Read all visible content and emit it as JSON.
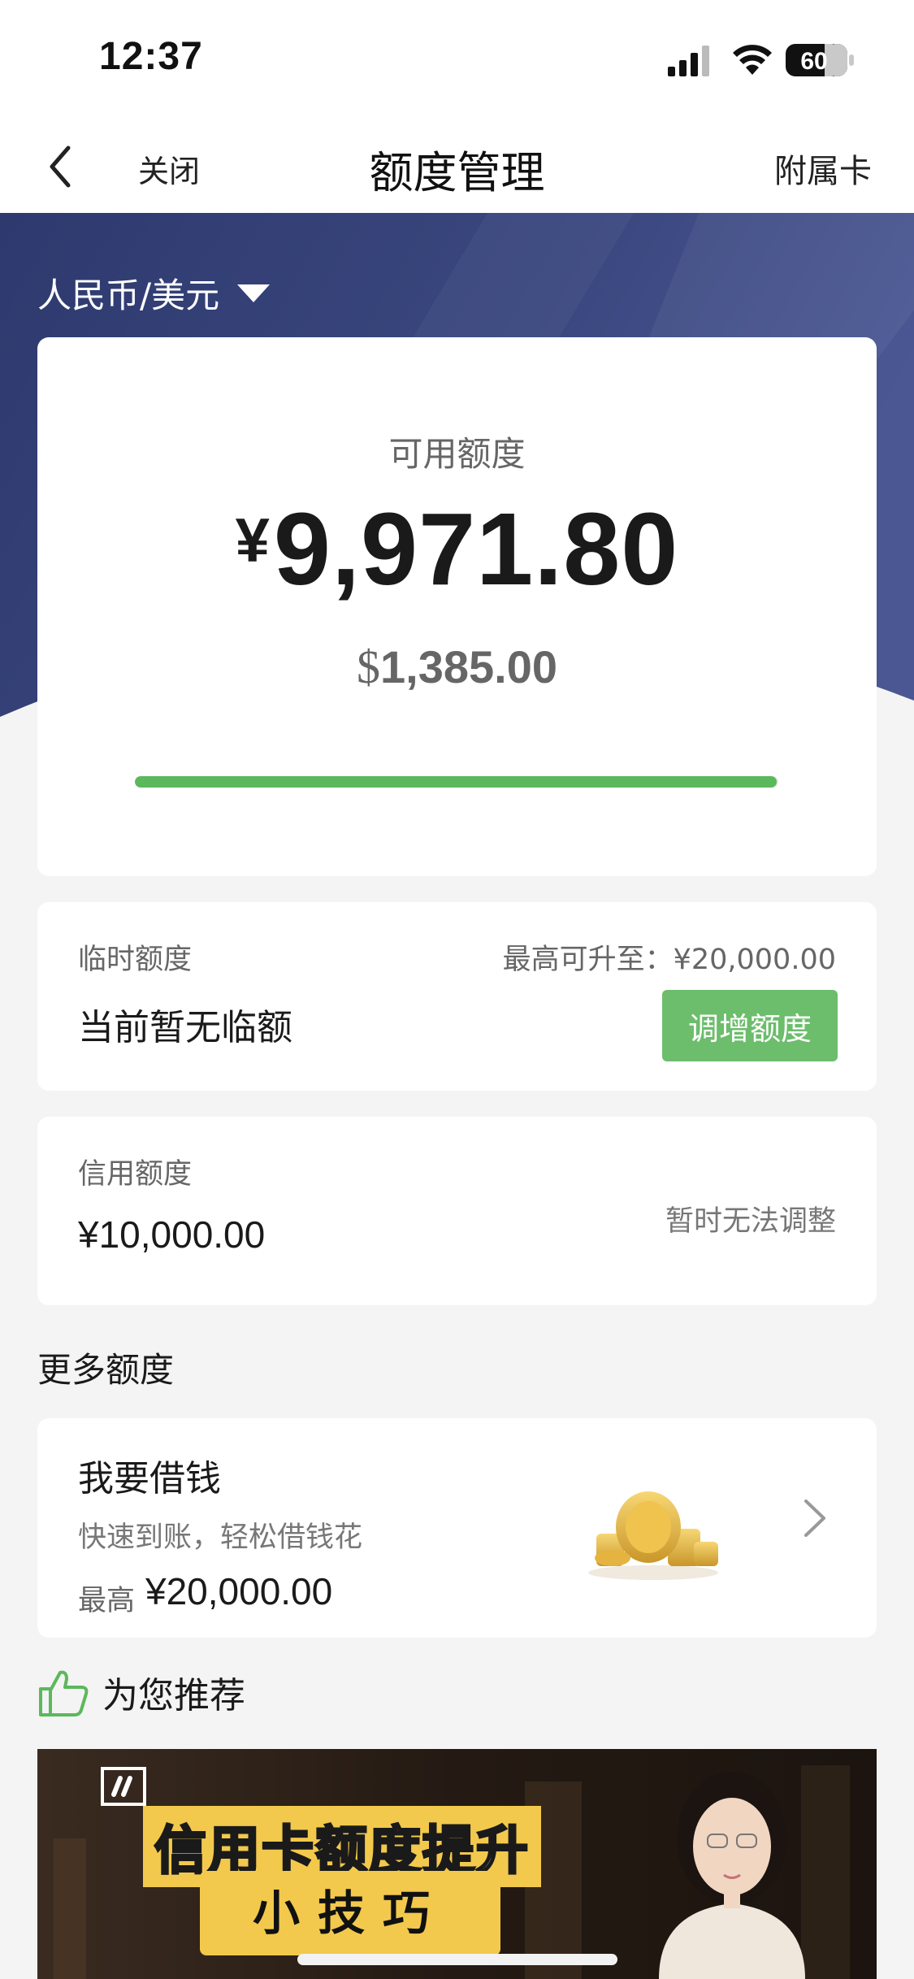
{
  "status_bar": {
    "time": "12:37",
    "battery": "60"
  },
  "nav": {
    "close_label": "关闭",
    "title": "额度管理",
    "right_label": "附属卡"
  },
  "currency_selector": {
    "label": "人民币/美元"
  },
  "available": {
    "label": "可用额度",
    "cny_symbol": "¥",
    "cny_value": "9,971.80",
    "usd_symbol": "$",
    "usd_value": "1,385.00",
    "progress_fraction": 0.997
  },
  "temporary": {
    "label": "临时额度",
    "max_text": "最高可升至：¥20,000.00",
    "value": "当前暂无临额",
    "button_label": "调增额度"
  },
  "credit": {
    "label": "信用额度",
    "value": "¥10,000.00",
    "status": "暂时无法调整"
  },
  "more": {
    "title": "更多额度",
    "borrow": {
      "title": "我要借钱",
      "subtitle": "快速到账，轻松借钱花",
      "max_label": "最高",
      "max_value": "¥20,000.00"
    }
  },
  "recommend": {
    "title": "为您推荐",
    "banner_title": "信用卡额度提升",
    "banner_sub": "小技巧"
  },
  "colors": {
    "accent_green": "#5cb85c",
    "hero_blue": "#34407a",
    "banner_yellow": "#f2c94c"
  }
}
